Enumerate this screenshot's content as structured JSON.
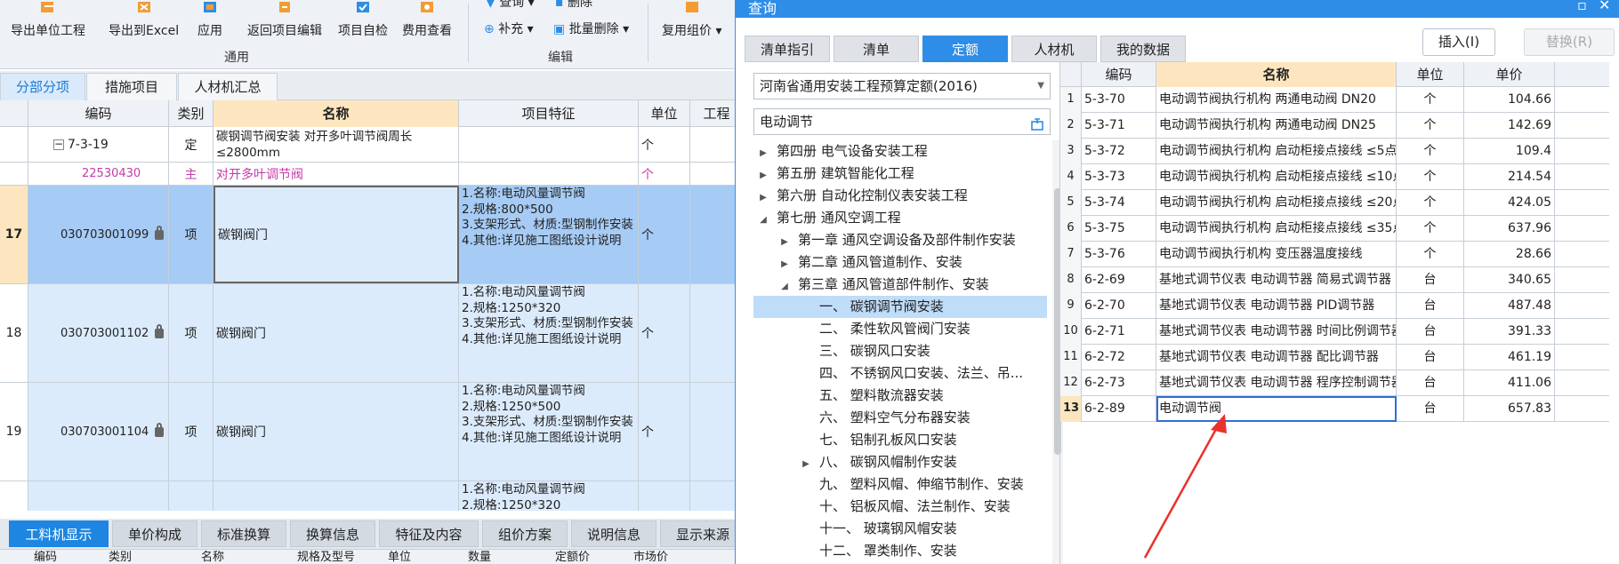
{
  "ribbon": {
    "buttons": [
      {
        "label": "导出单位工程",
        "icon": "export-unit-icon"
      },
      {
        "label": "导出到Excel",
        "icon": "export-excel-icon"
      },
      {
        "label": "应用",
        "icon": "apply-icon"
      },
      {
        "label": "返回项目编辑",
        "icon": "return-icon"
      },
      {
        "label": "项目自检",
        "icon": "check-icon"
      },
      {
        "label": "费用查看",
        "icon": "fee-view-icon"
      }
    ],
    "small_buttons": {
      "query": "查询",
      "delete": "删除",
      "supplement": "补充",
      "batch_delete": "批量删除",
      "reuse_price": "复用组价"
    },
    "groups": {
      "general": "通用",
      "edit": "编辑"
    }
  },
  "view_tabs": [
    "分部分项",
    "措施项目",
    "人材机汇总"
  ],
  "grid": {
    "headers": [
      "编码",
      "类别",
      "名称",
      "项目特征",
      "单位",
      "工程"
    ],
    "rows": [
      {
        "num": "",
        "code": "7-3-19",
        "type": "定",
        "name": "碳钢调节阀安装 对开多叶调节阀周长≤2800mm",
        "feature": "",
        "unit": "个"
      },
      {
        "num": "",
        "code": "22530430",
        "type": "主",
        "name": "对开多叶调节阀",
        "feature": "",
        "unit": "个"
      },
      {
        "num": "17",
        "code": "030703001099",
        "type": "项",
        "name": "碳钢阀门",
        "feature": "1.名称:电动风量调节阀\n2.规格:800*500\n3.支架形式、材质:型钢制作安装\n4.其他:详见施工图纸设计说明",
        "unit": "个"
      },
      {
        "num": "18",
        "code": "030703001102",
        "type": "项",
        "name": "碳钢阀门",
        "feature": "1.名称:电动风量调节阀\n2.规格:1250*320\n3.支架形式、材质:型钢制作安装\n4.其他:详见施工图纸设计说明",
        "unit": "个"
      },
      {
        "num": "19",
        "code": "030703001104",
        "type": "项",
        "name": "碳钢阀门",
        "feature": "1.名称:电动风量调节阀\n2.规格:1250*500\n3.支架形式、材质:型钢制作安装\n4.其他:详见施工图纸设计说明",
        "unit": "个"
      },
      {
        "num": "",
        "code": "",
        "type": "",
        "name": "",
        "feature": "1.名称:电动风量调节阀\n2.规格:1250*320",
        "unit": ""
      }
    ]
  },
  "bottom_tabs": [
    "工料机显示",
    "单价构成",
    "标准换算",
    "换算信息",
    "特征及内容",
    "组价方案",
    "说明信息",
    "显示来源"
  ],
  "bottom_headers": [
    "编码",
    "类别",
    "名称",
    "规格及型号",
    "单位",
    "数量",
    "定额价",
    "市场价"
  ],
  "dialog": {
    "title": "查询",
    "tabs": [
      "清单指引",
      "清单",
      "定额",
      "人材机",
      "我的数据"
    ],
    "insert_button": "插入(I)",
    "replace_button": "替换(R)",
    "quota_library": "河南省通用安装工程预算定额(2016)",
    "search_value": "电动调节",
    "tree": [
      {
        "label": "第四册 电气设备安装工程",
        "level": 0,
        "arrow": "right"
      },
      {
        "label": "第五册 建筑智能化工程",
        "level": 0,
        "arrow": "right"
      },
      {
        "label": "第六册 自动化控制仪表安装工程",
        "level": 0,
        "arrow": "right"
      },
      {
        "label": "第七册 通风空调工程",
        "level": 0,
        "arrow": "down"
      },
      {
        "label": "第一章 通风空调设备及部件制作安装",
        "level": 1,
        "arrow": "right"
      },
      {
        "label": "第二章 通风管道制作、安装",
        "level": 1,
        "arrow": "right"
      },
      {
        "label": "第三章 通风管道部件制作、安装",
        "level": 1,
        "arrow": "down"
      },
      {
        "label": "一、 碳钢调节阀安装",
        "level": 2,
        "arrow": ""
      },
      {
        "label": "二、 柔性软风管阀门安装",
        "level": 2,
        "arrow": ""
      },
      {
        "label": "三、 碳钢风口安装",
        "level": 2,
        "arrow": ""
      },
      {
        "label": "四、 不锈钢风口安装、法兰、吊...",
        "level": 2,
        "arrow": ""
      },
      {
        "label": "五、 塑料散流器安装",
        "level": 2,
        "arrow": ""
      },
      {
        "label": "六、 塑料空气分布器安装",
        "level": 2,
        "arrow": ""
      },
      {
        "label": "七、 铝制孔板风口安装",
        "level": 2,
        "arrow": ""
      },
      {
        "label": "八、 碳钢风帽制作安装",
        "level": 2,
        "arrow": "right"
      },
      {
        "label": "九、 塑料风帽、伸缩节制作、安装",
        "level": 2,
        "arrow": ""
      },
      {
        "label": "十、 铝板风帽、法兰制作、安装",
        "level": 2,
        "arrow": ""
      },
      {
        "label": "十一、 玻璃钢风帽安装",
        "level": 2,
        "arrow": ""
      },
      {
        "label": "十二、 罩类制作、安装",
        "level": 2,
        "arrow": ""
      }
    ],
    "table_headers": [
      "编码",
      "名称",
      "单位",
      "单价"
    ],
    "rows": [
      {
        "n": "1",
        "code": "5-3-70",
        "name": "电动调节阀执行机构 两通电动阀 DN20",
        "unit": "个",
        "price": "104.66"
      },
      {
        "n": "2",
        "code": "5-3-71",
        "name": "电动调节阀执行机构 两通电动阀 DN25",
        "unit": "个",
        "price": "142.69"
      },
      {
        "n": "3",
        "code": "5-3-72",
        "name": "电动调节阀执行机构 启动柜接点接线 ≤5点",
        "unit": "个",
        "price": "109.4"
      },
      {
        "n": "4",
        "code": "5-3-73",
        "name": "电动调节阀执行机构 启动柜接点接线 ≤10点",
        "unit": "个",
        "price": "214.54"
      },
      {
        "n": "5",
        "code": "5-3-74",
        "name": "电动调节阀执行机构 启动柜接点接线 ≤20点",
        "unit": "个",
        "price": "424.05"
      },
      {
        "n": "6",
        "code": "5-3-75",
        "name": "电动调节阀执行机构 启动柜接点接线 ≤35点",
        "unit": "个",
        "price": "637.96"
      },
      {
        "n": "7",
        "code": "5-3-76",
        "name": "电动调节阀执行机构 变压器温度接线",
        "unit": "个",
        "price": "28.66"
      },
      {
        "n": "8",
        "code": "6-2-69",
        "name": "基地式调节仪表 电动调节器 简易式调节器",
        "unit": "台",
        "price": "340.65"
      },
      {
        "n": "9",
        "code": "6-2-70",
        "name": "基地式调节仪表 电动调节器 PID调节器",
        "unit": "台",
        "price": "487.48"
      },
      {
        "n": "10",
        "code": "6-2-71",
        "name": "基地式调节仪表 电动调节器 时间比例调节器",
        "unit": "台",
        "price": "391.33"
      },
      {
        "n": "11",
        "code": "6-2-72",
        "name": "基地式调节仪表 电动调节器 配比调节器",
        "unit": "台",
        "price": "461.19"
      },
      {
        "n": "12",
        "code": "6-2-73",
        "name": "基地式调节仪表 电动调节器 程序控制调节器",
        "unit": "台",
        "price": "411.06"
      },
      {
        "n": "13",
        "code": "6-2-89",
        "name": "电动调节阀",
        "unit": "台",
        "price": "657.83"
      }
    ]
  },
  "colors": {
    "accent": "#2e8de6",
    "selected_row": "#a6cbf5",
    "name_header": "#fde6bf",
    "annotation_arrow": "#e8322b"
  }
}
